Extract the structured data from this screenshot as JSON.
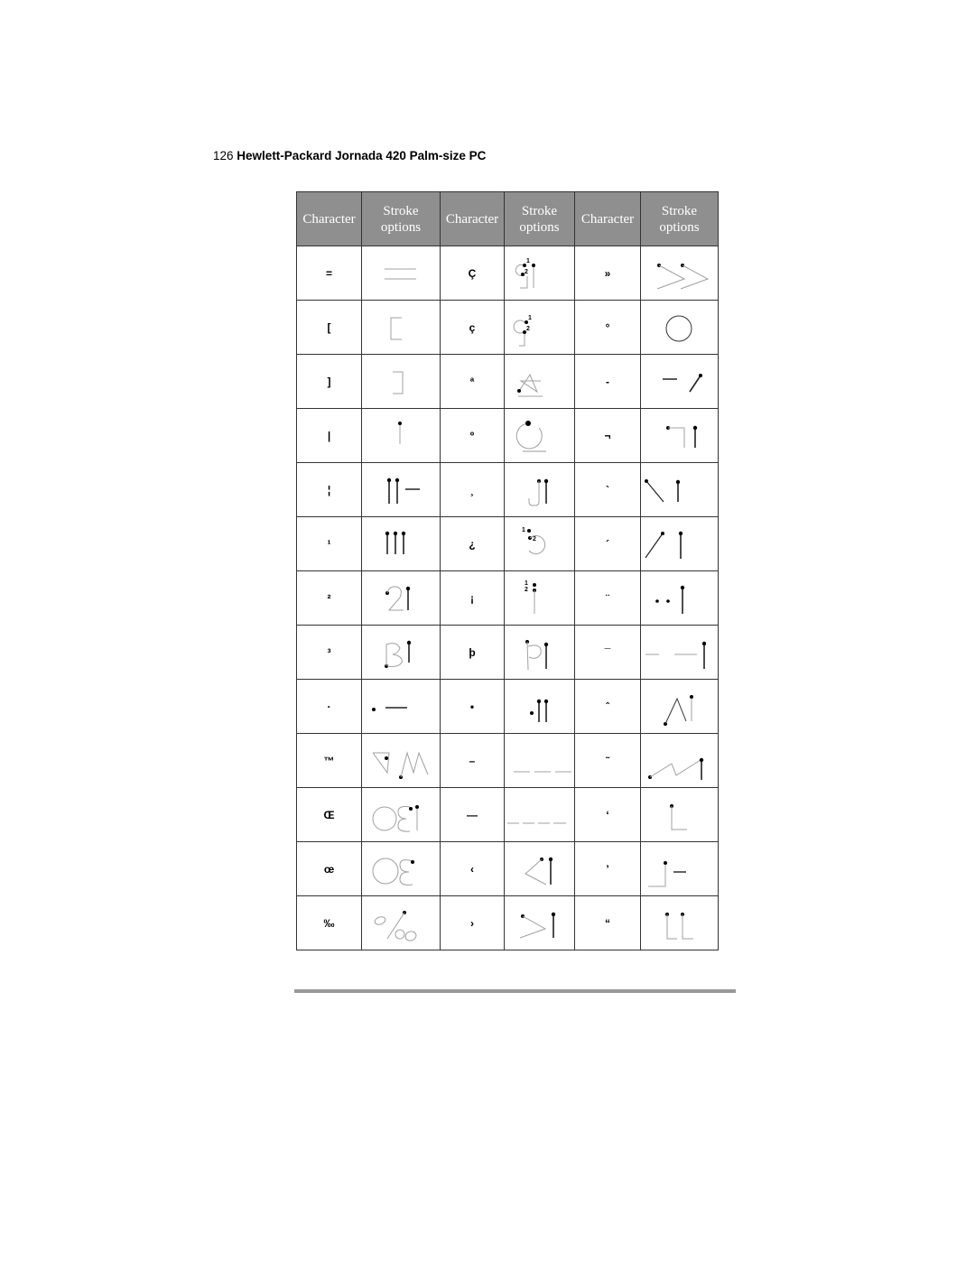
{
  "page": {
    "number": "126",
    "title": "Hewlett-Packard Jornada 420 Palm-size PC"
  },
  "table": {
    "headers": [
      {
        "line1": "Character",
        "line2": ""
      },
      {
        "line1": "Stroke",
        "line2": "options"
      },
      {
        "line1": "Character",
        "line2": ""
      },
      {
        "line1": "Stroke",
        "line2": "options"
      },
      {
        "line1": "Character",
        "line2": ""
      },
      {
        "line1": "Stroke",
        "line2": "options"
      }
    ],
    "rows": [
      {
        "c1": "=",
        "s1": "equals-strokes",
        "c2": "Ç",
        "s2": "c-cedilla-upper-strokes",
        "c3": "»",
        "s3": "right-guillemet-strokes"
      },
      {
        "c1": "[",
        "s1": "left-bracket-strokes",
        "c2": "ç",
        "s2": "c-cedilla-lower-strokes",
        "c3": "°",
        "s3": "degree-strokes"
      },
      {
        "c1": "]",
        "s1": "right-bracket-strokes",
        "c2": "ª",
        "s2": "feminine-ordinal-strokes",
        "c3": "-",
        "s3": "soft-hyphen-strokes"
      },
      {
        "c1": "|",
        "s1": "vertical-bar-strokes",
        "c2": "º",
        "s2": "masculine-ordinal-strokes",
        "c3": "¬",
        "s3": "not-sign-strokes"
      },
      {
        "c1": "¦",
        "s1": "broken-bar-strokes",
        "c2": "¸",
        "s2": "cedilla-strokes",
        "c3": "`",
        "s3": "grave-strokes"
      },
      {
        "c1": "¹",
        "s1": "superscript-one-strokes",
        "c2": "¿",
        "s2": "inverted-question-strokes",
        "c3": "´",
        "s3": "acute-strokes"
      },
      {
        "c1": "²",
        "s1": "superscript-two-strokes",
        "c2": "¡",
        "s2": "inverted-exclamation-strokes",
        "c3": "¨",
        "s3": "diaeresis-strokes"
      },
      {
        "c1": "³",
        "s1": "superscript-three-strokes",
        "c2": "þ",
        "s2": "thorn-strokes",
        "c3": "¯",
        "s3": "macron-strokes"
      },
      {
        "c1": "·",
        "s1": "middle-dot-strokes",
        "c2": "•",
        "s2": "bullet-strokes",
        "c3": "ˆ",
        "s3": "circumflex-strokes"
      },
      {
        "c1": "™",
        "s1": "trademark-strokes",
        "c2": "–",
        "s2": "en-dash-strokes",
        "c3": "˜",
        "s3": "tilde-strokes"
      },
      {
        "c1": "Œ",
        "s1": "oe-upper-strokes",
        "c2": "—",
        "s2": "em-dash-strokes",
        "c3": "‘",
        "s3": "left-single-quote-strokes"
      },
      {
        "c1": "œ",
        "s1": "oe-lower-strokes",
        "c2": "‹",
        "s2": "left-single-guillemet-strokes",
        "c3": "’",
        "s3": "right-single-quote-strokes"
      },
      {
        "c1": "‰",
        "s1": "per-mille-strokes",
        "c2": "›",
        "s2": "right-single-guillemet-strokes",
        "c3": "“",
        "s3": "left-double-quote-strokes"
      }
    ]
  }
}
